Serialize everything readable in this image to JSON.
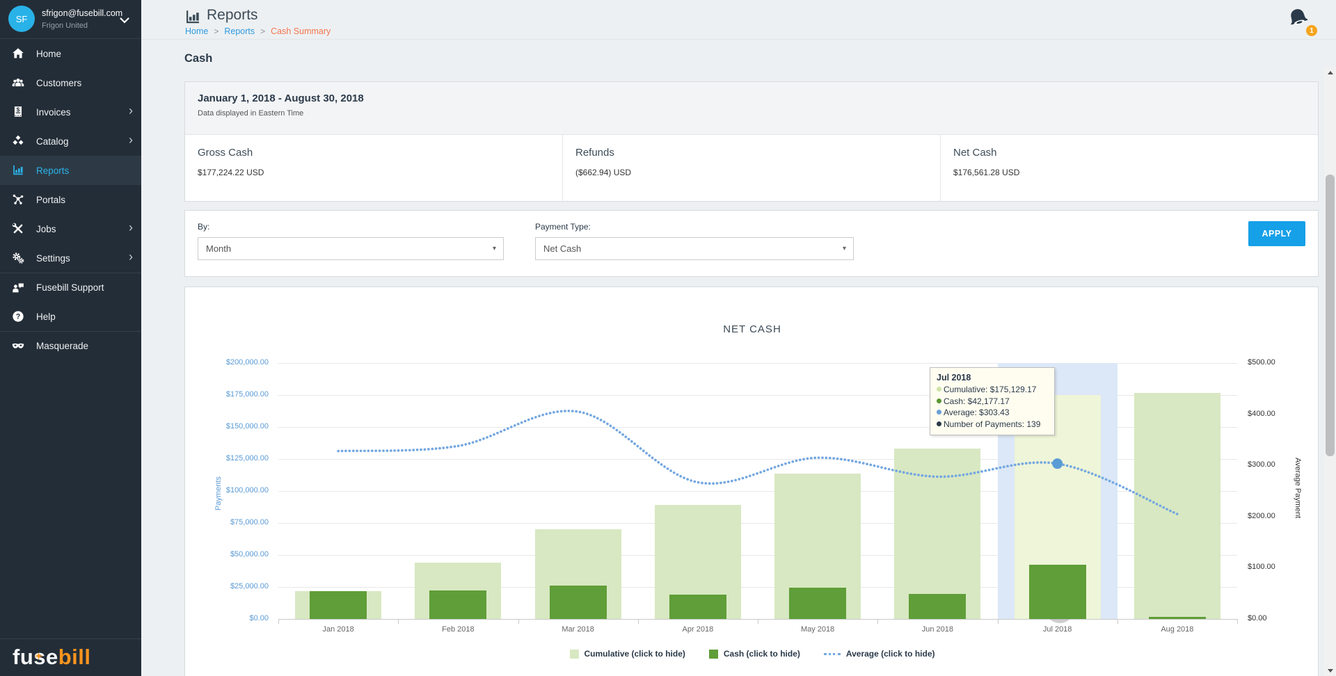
{
  "sidebar": {
    "user": {
      "initials": "SF",
      "email": "sfrigon@fusebill.com",
      "company": "Frigon United"
    },
    "items": [
      {
        "label": "Home",
        "icon": "home-icon"
      },
      {
        "label": "Customers",
        "icon": "customers-icon"
      },
      {
        "label": "Invoices",
        "icon": "invoices-icon",
        "chevron": true
      },
      {
        "label": "Catalog",
        "icon": "catalog-icon",
        "chevron": true
      },
      {
        "label": "Reports",
        "icon": "reports-icon",
        "active": true
      },
      {
        "label": "Portals",
        "icon": "portals-icon"
      },
      {
        "label": "Jobs",
        "icon": "jobs-icon",
        "chevron": true
      },
      {
        "label": "Settings",
        "icon": "settings-icon",
        "chevron": true
      },
      {
        "label": "Fusebill Support",
        "icon": "support-icon",
        "divider": true
      },
      {
        "label": "Help",
        "icon": "help-icon"
      },
      {
        "label": "Masquerade",
        "icon": "masquerade-icon",
        "divider": true
      }
    ],
    "logo": {
      "fuse": "fuse",
      "bill": "bill"
    }
  },
  "header": {
    "title": "Reports",
    "separator": ">",
    "breadcrumb": [
      {
        "label": "Home",
        "current": false
      },
      {
        "label": "Reports",
        "current": false
      },
      {
        "label": "Cash Summary",
        "current": true
      }
    ],
    "notification_count": "1"
  },
  "page": {
    "title": "Cash"
  },
  "summary": {
    "date_range": "January 1, 2018 - August 30, 2018",
    "timezone_note": "Data displayed in Eastern Time",
    "stats": [
      {
        "label": "Gross Cash",
        "value": "$177,224.22 USD"
      },
      {
        "label": "Refunds",
        "value": "($662.94) USD"
      },
      {
        "label": "Net Cash",
        "value": "$176,561.28 USD"
      }
    ]
  },
  "filters": {
    "by_label": "By:",
    "by_value": "Month",
    "payment_type_label": "Payment Type:",
    "payment_type_value": "Net Cash",
    "apply_label": "APPLY"
  },
  "chart_data": {
    "type": "bar",
    "title": "NET CASH",
    "categories": [
      "Jan 2018",
      "Feb 2018",
      "Mar 2018",
      "Apr 2018",
      "May 2018",
      "Jun 2018",
      "Jul 2018",
      "Aug 2018"
    ],
    "series": [
      {
        "name": "Cumulative (click to hide)",
        "type": "bar",
        "axis": "left",
        "color": "#d8e8c2",
        "highlight_color": "#eef5d8",
        "values": [
          21500,
          44000,
          70000,
          89000,
          113500,
          132952,
          175129.17,
          176561.28
        ]
      },
      {
        "name": "Cash (click to hide)",
        "type": "bar",
        "axis": "left",
        "color": "#5f9e38",
        "values": [
          21500,
          22500,
          26000,
          19000,
          24500,
          19452,
          42177.17,
          1432.11
        ]
      },
      {
        "name": "Average (click to hide)",
        "type": "line",
        "line_style": "dotted",
        "axis": "right",
        "color": "#74a7e0",
        "values": [
          328,
          338,
          405,
          267,
          315,
          278,
          303.43,
          205
        ]
      }
    ],
    "left_axis": {
      "label": "Payments",
      "min": 0,
      "max": 200000,
      "tick_labels": [
        "$200,000.00",
        "$175,000.00",
        "$150,000.00",
        "$125,000.00",
        "$100,000.00",
        "$75,000.00",
        "$50,000.00",
        "$25,000.00",
        "$0.00"
      ]
    },
    "right_axis": {
      "label": "Average Payment",
      "min": 0,
      "max": 500,
      "tick_labels": [
        "$500.00",
        "$400.00",
        "$300.00",
        "$200.00",
        "$100.00",
        "$0.00"
      ]
    },
    "grid": true,
    "legend_position": "bottom",
    "highlighted_category": "Jul 2018",
    "hover_point": {
      "series": "Average",
      "category": "Jul 2018",
      "value": 303.43,
      "dot_color": "#5b9bd5"
    },
    "tooltip": {
      "title": "Jul 2018",
      "rows": [
        {
          "label": "Cumulative",
          "value": "$175,129.17",
          "dot_color": "#cfe3aa"
        },
        {
          "label": "Cash",
          "value": "$42,177.17",
          "dot_color": "#5a9632"
        },
        {
          "label": "Average",
          "value": "$303.43",
          "dot_color": "#6b9fd8"
        },
        {
          "label": "Number of Payments",
          "value": "139",
          "dot_color": "#2b3a4a"
        }
      ]
    }
  }
}
